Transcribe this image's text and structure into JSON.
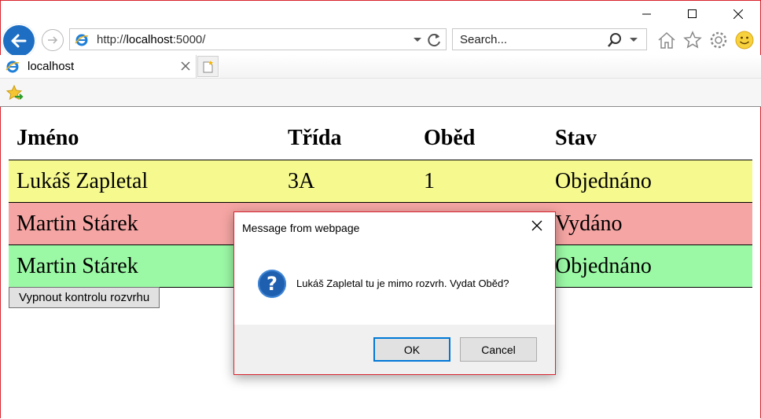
{
  "browser": {
    "address_url": "http://",
    "address_host": "localhost",
    "address_port": ":5000/",
    "search_placeholder": "Search...",
    "tab_title": "localhost"
  },
  "table": {
    "headers": [
      "Jméno",
      "Třída",
      "Oběd",
      "Stav"
    ],
    "rows": [
      {
        "name": "Lukáš Zapletal",
        "class": "3A",
        "lunch": "1",
        "status": "Objednáno",
        "color": "#f5f98e"
      },
      {
        "name": "Martin Stárek",
        "class": "",
        "lunch": "",
        "status": "Vydáno",
        "color": "#f5a5a3"
      },
      {
        "name": "Martin Stárek",
        "class": "",
        "lunch": "",
        "status": "Objednáno",
        "color": "#9bf9a5"
      }
    ]
  },
  "toggle_button_label": "Vypnout kontrolu rozvrhu",
  "dialog": {
    "title": "Message from webpage",
    "message": "Lukáš Zapletal tu je mimo rozvrh. Vydat Oběd?",
    "ok_label": "OK",
    "cancel_label": "Cancel",
    "icon": "question-icon"
  },
  "colors": {
    "accent": "#1e6fc4",
    "window_border": "#d9232e"
  }
}
